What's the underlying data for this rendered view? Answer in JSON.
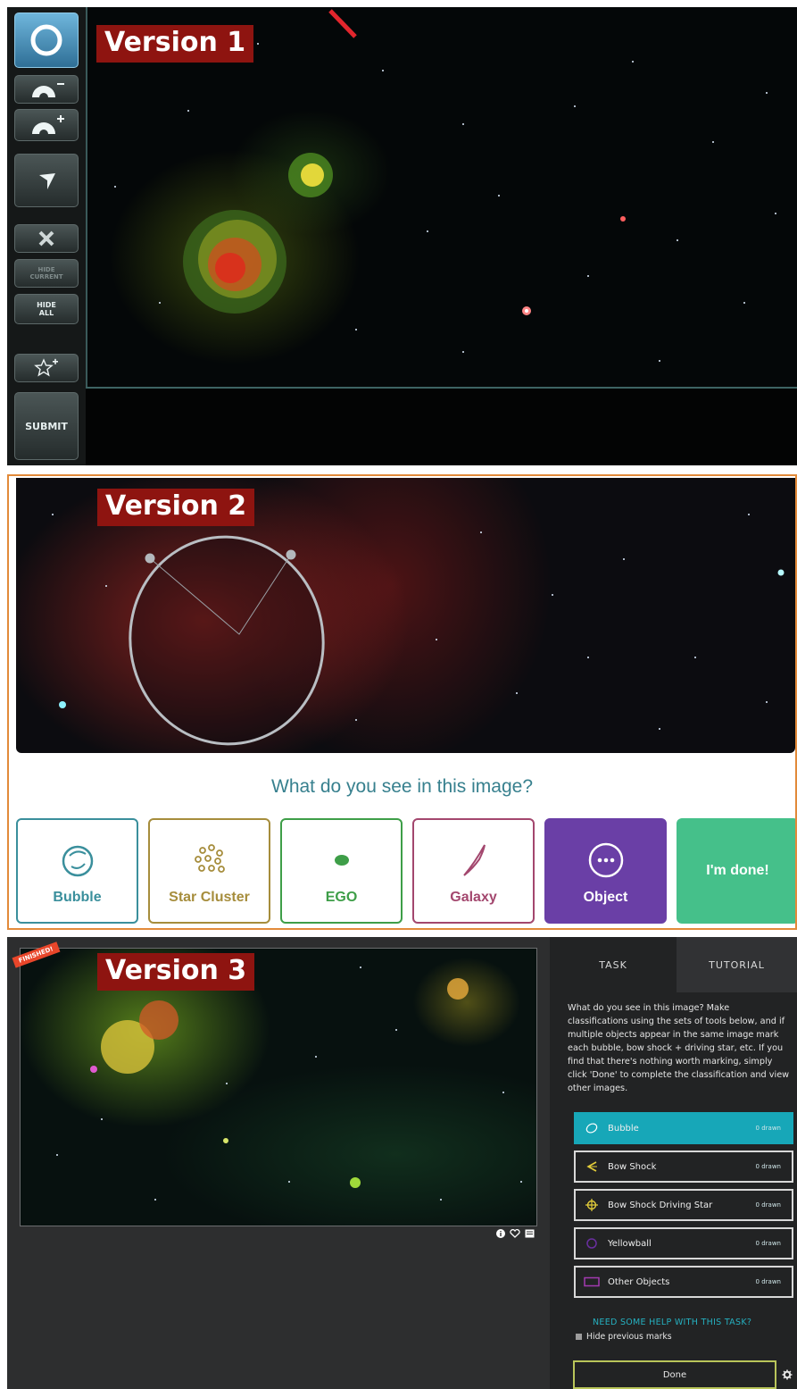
{
  "version1": {
    "badge": "Version 1",
    "tools": {
      "hide_current": "HIDE\nCURRENT",
      "hide_all": "HIDE\nALL",
      "submit": "SUBMIT"
    }
  },
  "version2": {
    "badge": "Version 2",
    "question": "What do you see in this image?",
    "buttons": [
      {
        "label": "Bubble",
        "color": "#3a8f9c"
      },
      {
        "label": "Star Cluster",
        "color": "#a68d3c"
      },
      {
        "label": "EGO",
        "color": "#3e9e48"
      },
      {
        "label": "Galaxy",
        "color": "#a3476e"
      },
      {
        "label": "Object",
        "color": "#6a3fa6"
      },
      {
        "label": "I'm done!",
        "color": "#45c08a"
      }
    ]
  },
  "version3": {
    "badge": "Version 3",
    "finished_tag": "FINISHED!",
    "tabs": {
      "task": "TASK",
      "tutorial": "TUTORIAL"
    },
    "instructions": "What do you see in this image? Make classifications using the sets of tools below, and if multiple objects appear in the same image mark each bubble, bow shock + driving star, etc. If you find that there's nothing worth marking, simply click 'Done' to complete the classification and view other images.",
    "tools": [
      {
        "label": "Bubble",
        "count": "0 drawn"
      },
      {
        "label": "Bow Shock",
        "count": "0 drawn"
      },
      {
        "label": "Bow Shock Driving Star",
        "count": "0 drawn"
      },
      {
        "label": "Yellowball",
        "count": "0 drawn"
      },
      {
        "label": "Other Objects",
        "count": "0 drawn"
      }
    ],
    "help_link": "NEED SOME HELP WITH THIS TASK?",
    "hide_marks": "Hide previous marks",
    "done": "Done"
  }
}
